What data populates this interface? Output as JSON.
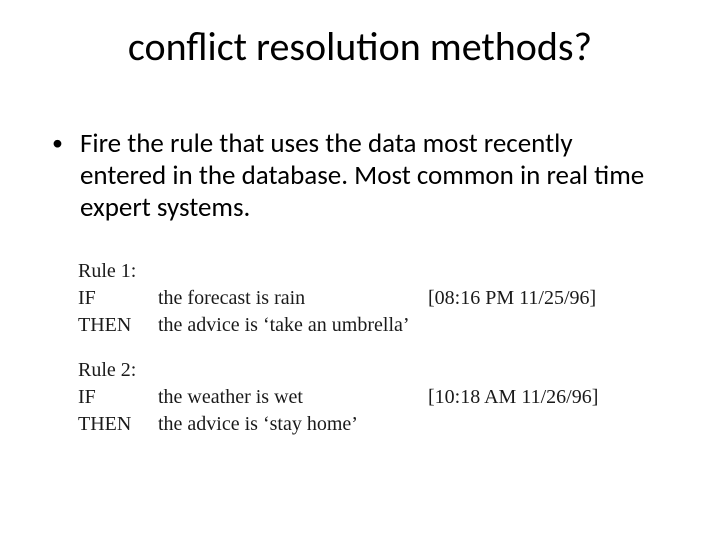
{
  "title": "conflict resolution methods?",
  "bullet": "Fire the rule that uses the data most recently entered in the database. Most common in real time expert systems.",
  "rules": [
    {
      "label": "Rule 1:",
      "if_kw": "IF",
      "if_cond": "the forecast is rain",
      "if_ts": "[08:16 PM 11/25/96]",
      "then_kw": "THEN",
      "then_cond": "the advice is ‘take an umbrella’"
    },
    {
      "label": "Rule 2:",
      "if_kw": "IF",
      "if_cond": "the weather is wet",
      "if_ts": "[10:18 AM 11/26/96]",
      "then_kw": "THEN",
      "then_cond": "the advice is ‘stay home’"
    }
  ]
}
